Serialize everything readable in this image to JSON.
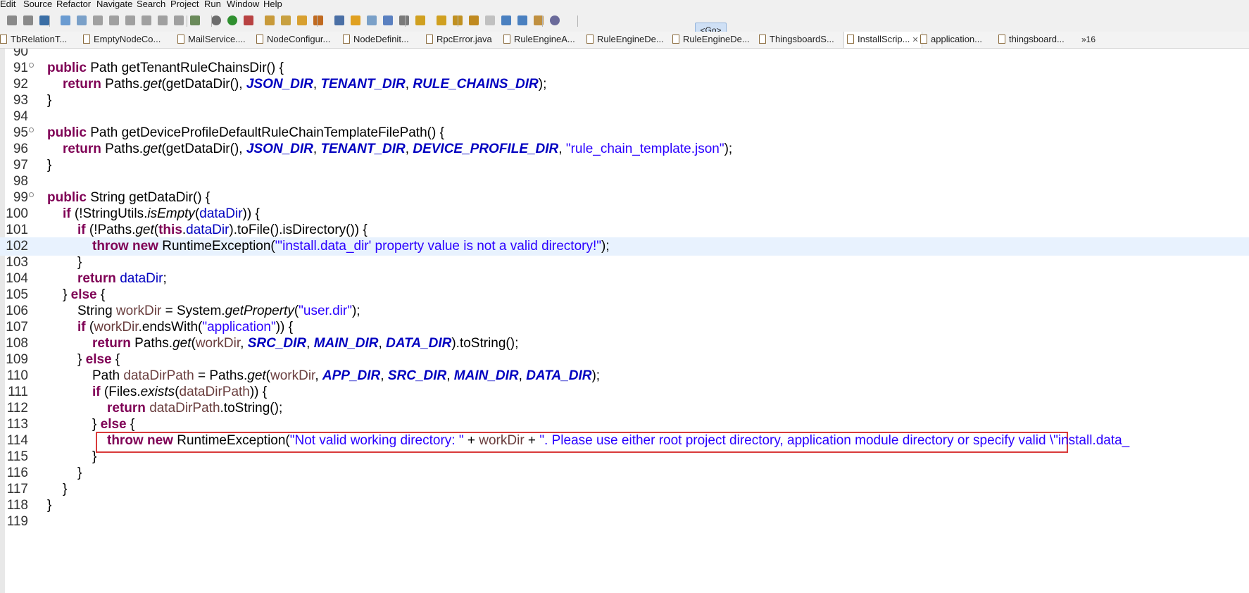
{
  "menu": [
    "Edit",
    "Source",
    "Refactor",
    "Navigate",
    "Search",
    "Project",
    "Run",
    "Window",
    "Help"
  ],
  "toolbar": {
    "go_label": "<Go>",
    "icons": [
      "save-icon",
      "save-all-icon",
      "console-icon",
      "resume-icon",
      "suspend-icon",
      "terminate-icon",
      "disconnect-icon",
      "step-into-icon",
      "step-over-icon",
      "step-return-icon",
      "drop-to-frame-icon",
      "use-step-filters-icon",
      "debug-icon",
      "run-icon",
      "coverage-icon",
      "new-project-icon",
      "open-type-icon",
      "open-task-icon",
      "search-icon",
      "toggle-mark-occurrences-icon",
      "toggle-highlight-icon",
      "toggle-breadcrumb-icon",
      "block-selection-icon",
      "show-whitespace-icon",
      "next-annotation-icon",
      "prev-annotation-icon",
      "last-edit-icon",
      "back-icon",
      "forward-icon",
      "pin-editor-icon",
      "maximize-icon",
      "java-perspective-icon",
      "debug-perspective-icon"
    ]
  },
  "tabs": [
    {
      "label": "TbRelationT...",
      "active": false
    },
    {
      "label": "EmptyNodeCo...",
      "active": false
    },
    {
      "label": "MailService....",
      "active": false
    },
    {
      "label": "NodeConfigur...",
      "active": false
    },
    {
      "label": "NodeDefinit...",
      "active": false
    },
    {
      "label": "RpcError.java",
      "active": false
    },
    {
      "label": "RuleEngineA...",
      "active": false
    },
    {
      "label": "RuleEngineDe...",
      "active": false
    },
    {
      "label": "RuleEngineDe...",
      "active": false
    },
    {
      "label": "ThingsboardS...",
      "active": false
    },
    {
      "label": "InstallScrip...",
      "active": true
    },
    {
      "label": "application...",
      "active": false
    },
    {
      "label": "thingsboard...",
      "active": false
    }
  ],
  "tab_overflow": "»16",
  "editor": {
    "current_line": 102,
    "highlighted_line": 114,
    "lines": [
      {
        "n": "90",
        "tokens": []
      },
      {
        "n": "91",
        "fold": true,
        "indent": 0,
        "tokens": [
          [
            "kw",
            "public"
          ],
          [
            "",
            " Path getTenantRuleChainsDir() {"
          ]
        ]
      },
      {
        "n": "92",
        "indent": 1,
        "tokens": [
          [
            "kw",
            "return"
          ],
          [
            "",
            " Paths."
          ],
          [
            "it",
            "get"
          ],
          [
            "",
            "(getDataDir(), "
          ],
          [
            "cs",
            "JSON_DIR"
          ],
          [
            "",
            ", "
          ],
          [
            "cs",
            "TENANT_DIR"
          ],
          [
            "",
            ", "
          ],
          [
            "cs",
            "RULE_CHAINS_DIR"
          ],
          [
            "",
            ");"
          ]
        ]
      },
      {
        "n": "93",
        "indent": 0,
        "tokens": [
          [
            "",
            "}"
          ]
        ]
      },
      {
        "n": "94",
        "tokens": []
      },
      {
        "n": "95",
        "fold": true,
        "indent": 0,
        "tokens": [
          [
            "kw",
            "public"
          ],
          [
            "",
            " Path getDeviceProfileDefaultRuleChainTemplateFilePath() {"
          ]
        ]
      },
      {
        "n": "96",
        "indent": 1,
        "tokens": [
          [
            "kw",
            "return"
          ],
          [
            "",
            " Paths."
          ],
          [
            "it",
            "get"
          ],
          [
            "",
            "(getDataDir(), "
          ],
          [
            "cs",
            "JSON_DIR"
          ],
          [
            "",
            ", "
          ],
          [
            "cs",
            "TENANT_DIR"
          ],
          [
            "",
            ", "
          ],
          [
            "cs",
            "DEVICE_PROFILE_DIR"
          ],
          [
            "",
            ", "
          ],
          [
            "st",
            "\"rule_chain_template.json\""
          ],
          [
            "",
            ");"
          ]
        ]
      },
      {
        "n": "97",
        "indent": 0,
        "tokens": [
          [
            "",
            "}"
          ]
        ]
      },
      {
        "n": "98",
        "tokens": []
      },
      {
        "n": "99",
        "fold": true,
        "indent": 0,
        "tokens": [
          [
            "kw",
            "public"
          ],
          [
            "",
            " String getDataDir() {"
          ]
        ]
      },
      {
        "n": "100",
        "indent": 1,
        "tokens": [
          [
            "kw",
            "if"
          ],
          [
            "",
            " (!StringUtils."
          ],
          [
            "it",
            "isEmpty"
          ],
          [
            "",
            "("
          ],
          [
            "fi",
            "dataDir"
          ],
          [
            "",
            "))"
          ],
          [
            "",
            " {"
          ]
        ]
      },
      {
        "n": "101",
        "indent": 2,
        "tokens": [
          [
            "kw",
            "if"
          ],
          [
            "",
            " (!Paths."
          ],
          [
            "it",
            "get"
          ],
          [
            "",
            "("
          ],
          [
            "kw",
            "this"
          ],
          [
            "",
            "."
          ],
          [
            "fi",
            "dataDir"
          ],
          [
            "",
            ").toFile().isDirectory()) {"
          ]
        ]
      },
      {
        "n": "102",
        "indent": 3,
        "tokens": [
          [
            "kw",
            "throw"
          ],
          [
            "",
            " "
          ],
          [
            "kw",
            "new"
          ],
          [
            "",
            " RuntimeException("
          ],
          [
            "st",
            "\"'install.data_dir' property value is not a valid directory!\""
          ],
          [
            "",
            ");"
          ]
        ]
      },
      {
        "n": "103",
        "indent": 2,
        "tokens": [
          [
            "",
            "}"
          ]
        ]
      },
      {
        "n": "104",
        "indent": 2,
        "tokens": [
          [
            "kw",
            "return"
          ],
          [
            "",
            " "
          ],
          [
            "fi",
            "dataDir"
          ],
          [
            "",
            ";"
          ]
        ]
      },
      {
        "n": "105",
        "indent": 1,
        "tokens": [
          [
            "",
            "} "
          ],
          [
            "kw",
            "else"
          ],
          [
            "",
            " {"
          ]
        ]
      },
      {
        "n": "106",
        "indent": 2,
        "tokens": [
          [
            "",
            "String "
          ],
          [
            "lv",
            "workDir"
          ],
          [
            "",
            " = System."
          ],
          [
            "it",
            "getProperty"
          ],
          [
            "",
            "("
          ],
          [
            "st",
            "\"user.dir\""
          ],
          [
            "",
            ");"
          ]
        ]
      },
      {
        "n": "107",
        "indent": 2,
        "tokens": [
          [
            "kw",
            "if"
          ],
          [
            "",
            " ("
          ],
          [
            "lv",
            "workDir"
          ],
          [
            "",
            ".endsWith("
          ],
          [
            "st",
            "\"application\""
          ],
          [
            "",
            "))"
          ],
          [
            "",
            " {"
          ]
        ]
      },
      {
        "n": "108",
        "indent": 3,
        "tokens": [
          [
            "kw",
            "return"
          ],
          [
            "",
            " Paths."
          ],
          [
            "it",
            "get"
          ],
          [
            "",
            "("
          ],
          [
            "lv",
            "workDir"
          ],
          [
            "",
            ", "
          ],
          [
            "cs",
            "SRC_DIR"
          ],
          [
            "",
            ", "
          ],
          [
            "cs",
            "MAIN_DIR"
          ],
          [
            "",
            ", "
          ],
          [
            "cs",
            "DATA_DIR"
          ],
          [
            "",
            ").toString();"
          ]
        ]
      },
      {
        "n": "109",
        "indent": 2,
        "tokens": [
          [
            "",
            "} "
          ],
          [
            "kw",
            "else"
          ],
          [
            "",
            " {"
          ]
        ]
      },
      {
        "n": "110",
        "indent": 3,
        "tokens": [
          [
            "",
            "Path "
          ],
          [
            "lv",
            "dataDirPath"
          ],
          [
            "",
            " = Paths."
          ],
          [
            "it",
            "get"
          ],
          [
            "",
            "("
          ],
          [
            "lv",
            "workDir"
          ],
          [
            "",
            ", "
          ],
          [
            "cs",
            "APP_DIR"
          ],
          [
            "",
            ", "
          ],
          [
            "cs",
            "SRC_DIR"
          ],
          [
            "",
            ", "
          ],
          [
            "cs",
            "MAIN_DIR"
          ],
          [
            "",
            ", "
          ],
          [
            "cs",
            "DATA_DIR"
          ],
          [
            "",
            ");"
          ]
        ]
      },
      {
        "n": "111",
        "indent": 3,
        "tokens": [
          [
            "kw",
            "if"
          ],
          [
            "",
            " (Files."
          ],
          [
            "it",
            "exists"
          ],
          [
            "",
            "("
          ],
          [
            "lv",
            "dataDirPath"
          ],
          [
            "",
            "))"
          ],
          [
            "",
            " {"
          ]
        ]
      },
      {
        "n": "112",
        "indent": 4,
        "tokens": [
          [
            "kw",
            "return"
          ],
          [
            "",
            " "
          ],
          [
            "lv",
            "dataDirPath"
          ],
          [
            "",
            ".toString();"
          ]
        ]
      },
      {
        "n": "113",
        "indent": 3,
        "tokens": [
          [
            "",
            "} "
          ],
          [
            "kw",
            "else"
          ],
          [
            "",
            " {"
          ]
        ]
      },
      {
        "n": "114",
        "indent": 4,
        "tokens": [
          [
            "kw",
            "throw"
          ],
          [
            "",
            " "
          ],
          [
            "kw",
            "new"
          ],
          [
            "",
            " RuntimeException("
          ],
          [
            "st",
            "\"Not valid working directory: \""
          ],
          [
            "",
            " + "
          ],
          [
            "lv",
            "workDir"
          ],
          [
            "",
            " + "
          ],
          [
            "st",
            "\". Please use either root project directory, application module directory or specify valid \\\"install.data_"
          ]
        ]
      },
      {
        "n": "115",
        "indent": 3,
        "tokens": [
          [
            "",
            "}"
          ]
        ]
      },
      {
        "n": "116",
        "indent": 2,
        "tokens": [
          [
            "",
            "}"
          ]
        ]
      },
      {
        "n": "117",
        "indent": 1,
        "tokens": [
          [
            "",
            "}"
          ]
        ]
      },
      {
        "n": "118",
        "indent": 0,
        "tokens": [
          [
            "",
            "}"
          ]
        ]
      },
      {
        "n": "119",
        "tokens": []
      }
    ]
  }
}
